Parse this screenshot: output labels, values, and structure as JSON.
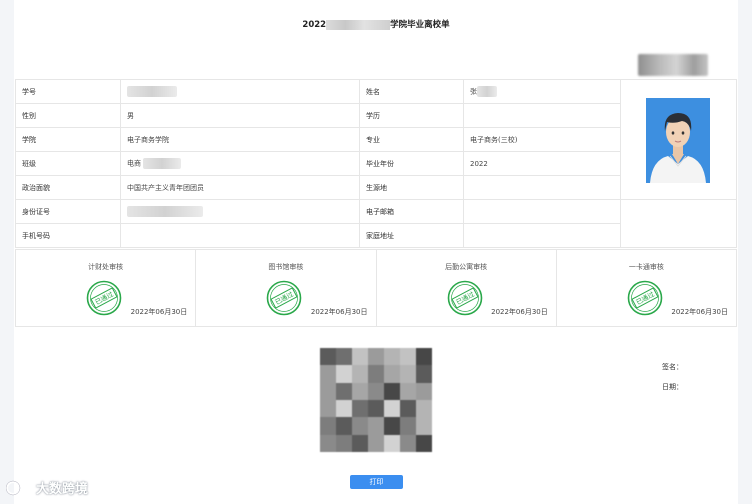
{
  "title": {
    "prefix": "2022",
    "suffix": "学院毕业离校单"
  },
  "info": {
    "student_id_label": "学号",
    "name_label": "姓名",
    "name_value": "张",
    "gender_label": "性别",
    "gender_value": "男",
    "education_label": "学历",
    "education_value": "",
    "college_label": "学院",
    "college_value": "电子商务学院",
    "major_label": "专业",
    "major_value": "电子商务(三校)",
    "class_label": "班级",
    "class_value": "电商",
    "grad_year_label": "毕业年份",
    "grad_year_value": "2022",
    "political_label": "政治面貌",
    "political_value": "中国共产主义青年团团员",
    "origin_label": "生源地",
    "origin_value": "",
    "idcard_label": "身份证号",
    "email_label": "电子邮箱",
    "email_value": "",
    "phone_label": "手机号码",
    "phone_value": "",
    "address_label": "家庭地址",
    "address_value": ""
  },
  "approvals": [
    {
      "title": "计财处审核",
      "stamp": "已通过",
      "date": "2022年06月30日"
    },
    {
      "title": "图书馆审核",
      "stamp": "已通过",
      "date": "2022年06月30日"
    },
    {
      "title": "后勤公寓审核",
      "stamp": "已通过",
      "date": "2022年06月30日"
    },
    {
      "title": "一卡通审核",
      "stamp": "已通过",
      "date": "2022年06月30日"
    }
  ],
  "signature_label": "签名：",
  "date_label": "日期：",
  "print_button": "打印",
  "watermark_text": "大数跨境",
  "colors": {
    "accent": "#3b8ef0",
    "stamp_green": "#2aa84a",
    "photo_bg": "#3d8fe0"
  }
}
